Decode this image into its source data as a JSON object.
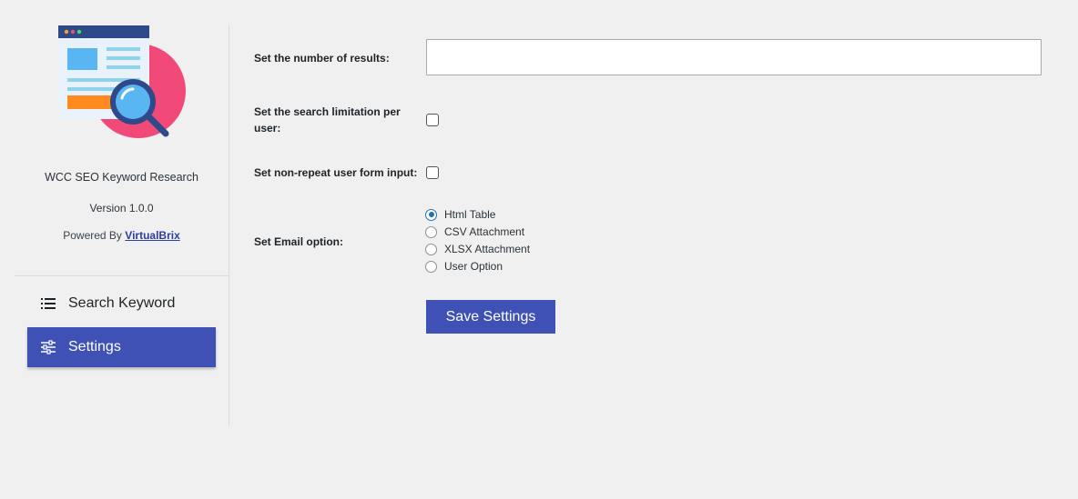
{
  "sidebar": {
    "plugin_name": "WCC SEO Keyword Research",
    "version": "Version 1.0.0",
    "powered_prefix": "Powered By",
    "powered_link": "VirtualBrix",
    "nav": [
      {
        "label": "Search Keyword",
        "icon": "list-icon",
        "active": false
      },
      {
        "label": "Settings",
        "icon": "sliders-icon",
        "active": true
      }
    ],
    "accent_color": "#3f51b5"
  },
  "form": {
    "results_label": "Set the number of results:",
    "results_value": "",
    "search_limit_label": "Set the search limitation per user:",
    "search_limit_checked": false,
    "non_repeat_label": "Set non-repeat user form input:",
    "non_repeat_checked": false,
    "email_label": "Set Email option:",
    "email_options": [
      {
        "label": "Html Table",
        "checked": true
      },
      {
        "label": "CSV Attachment",
        "checked": false
      },
      {
        "label": "XLSX Attachment",
        "checked": false
      },
      {
        "label": "User Option",
        "checked": false
      }
    ],
    "save_label": "Save Settings"
  }
}
